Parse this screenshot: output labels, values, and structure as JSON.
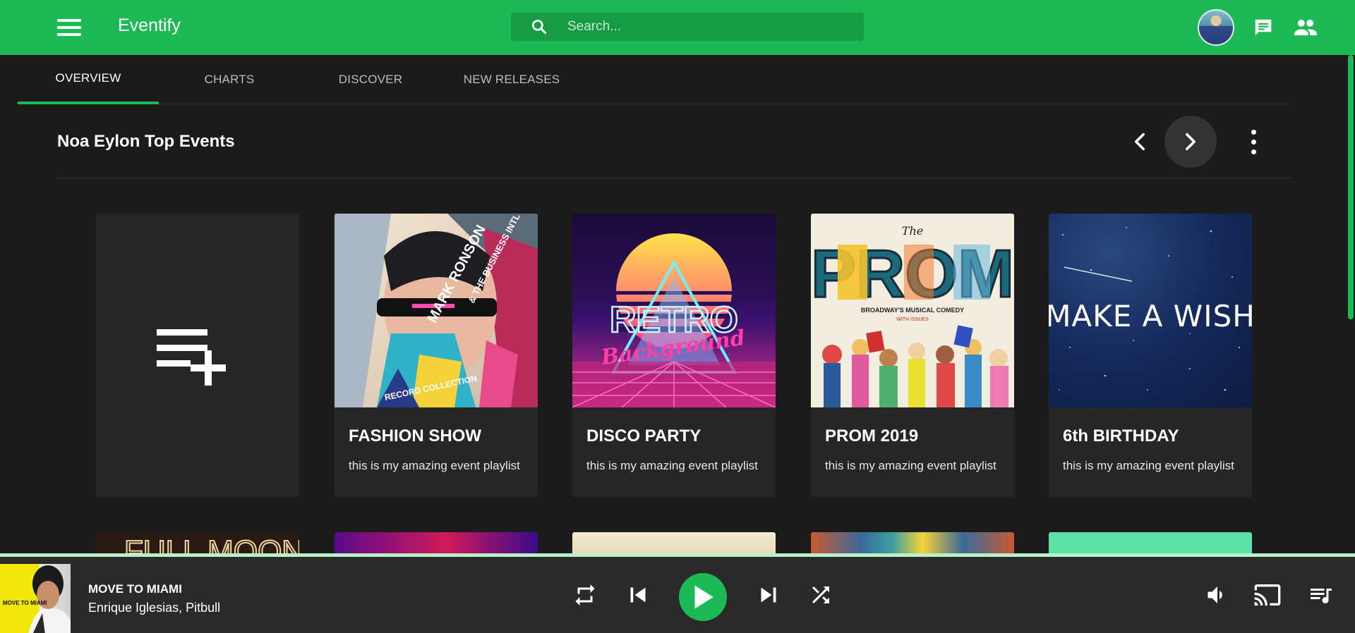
{
  "app": {
    "title": "Eventify",
    "accent": "#1db954"
  },
  "search": {
    "placeholder": "Search..."
  },
  "tabs": [
    {
      "label": "OVERVIEW",
      "active": true
    },
    {
      "label": "CHARTS",
      "active": false
    },
    {
      "label": "DISCOVER",
      "active": false
    },
    {
      "label": "NEW RELEASES",
      "active": false
    }
  ],
  "section": {
    "title": "Noa Eylon Top Events"
  },
  "cards": [
    {
      "title": "FASHION SHOW",
      "description": "this is my amazing event playlist",
      "art": {
        "line1": "MARK RONSON",
        "line2": "& THE BUSINESS INTL",
        "line3": "RECORD COLLECTION"
      }
    },
    {
      "title": "DISCO PARTY",
      "description": "this is my amazing event playlist",
      "art": {
        "line1": "RETRO",
        "line2": "Background"
      }
    },
    {
      "title": "PROM 2019",
      "description": "this is my amazing event playlist",
      "art": {
        "line1": "The",
        "line2": "PROM",
        "line3": "BROADWAY'S MUSICAL COMEDY",
        "line4": "WITH ISSUES"
      }
    },
    {
      "title": "6th BIRTHDAY",
      "description": "this is my amazing event playlist",
      "art": {
        "line1": "MAKE A WISH"
      }
    }
  ],
  "peek_row": [
    {
      "art_text": "FULL MOON"
    }
  ],
  "player": {
    "song_title": "MOVE TO MIAMI",
    "artist": "Enrique Iglesias, Pitbull",
    "cover_text": "MOVE TO MIAMI"
  },
  "icons": {
    "menu": "menu-icon",
    "search": "search-icon",
    "chat": "chat-icon",
    "people": "people-icon",
    "prev": "chevron-left-icon",
    "next": "chevron-right-icon",
    "more": "more-vertical-icon",
    "add_playlist": "playlist-add-icon",
    "repeat": "repeat-icon",
    "skip_prev": "skip-previous-icon",
    "play": "play-icon",
    "skip_next": "skip-next-icon",
    "shuffle": "shuffle-icon",
    "volume": "volume-icon",
    "cast": "cast-icon",
    "queue": "queue-music-icon"
  }
}
